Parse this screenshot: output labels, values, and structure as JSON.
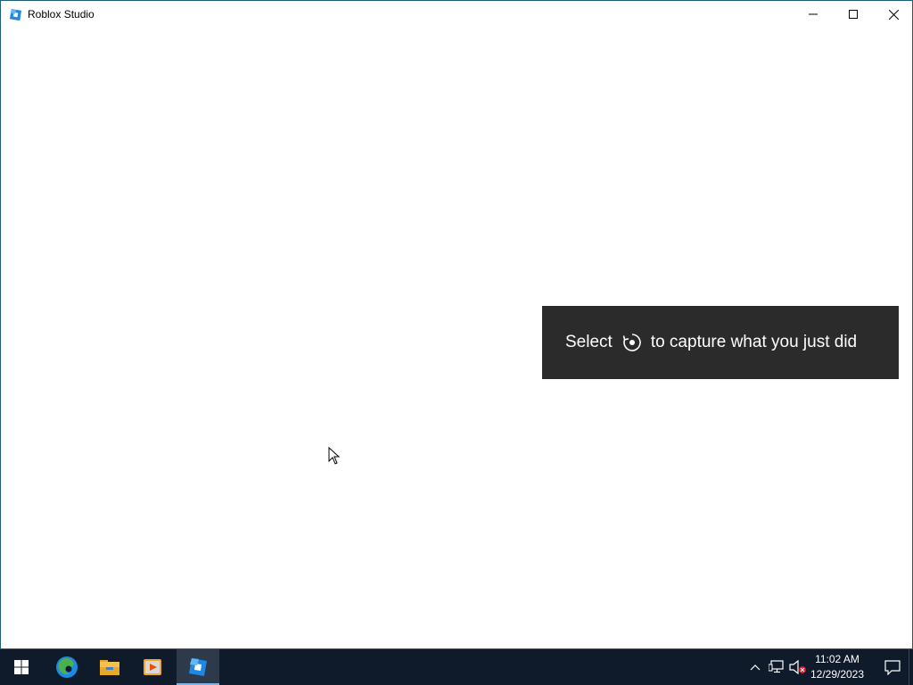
{
  "window": {
    "title": "Roblox Studio",
    "controls": {
      "minimize": "minimize-icon",
      "maximize": "maximize-icon",
      "close": "close-icon"
    }
  },
  "toast": {
    "text_before": "Select",
    "icon": "record-icon",
    "text_after": "to capture what you just did"
  },
  "taskbar": {
    "items": [
      {
        "name": "start",
        "icon": "windows-icon"
      },
      {
        "name": "edge",
        "icon": "edge-icon"
      },
      {
        "name": "file-explorer",
        "icon": "folder-icon"
      },
      {
        "name": "media-player",
        "icon": "media-player-icon"
      },
      {
        "name": "roblox-studio",
        "icon": "roblox-studio-icon",
        "active": true
      }
    ],
    "tray": {
      "icons": [
        "chevron-up-icon",
        "network-icon",
        "volume-muted-icon"
      ],
      "time": "11:02 AM",
      "date": "12/29/2023",
      "notification_icon": "notification-icon"
    }
  },
  "colors": {
    "taskbar_bg": "#0f1b2a",
    "toast_bg": "#2b2b2b",
    "window_border": "#1f5f78"
  }
}
